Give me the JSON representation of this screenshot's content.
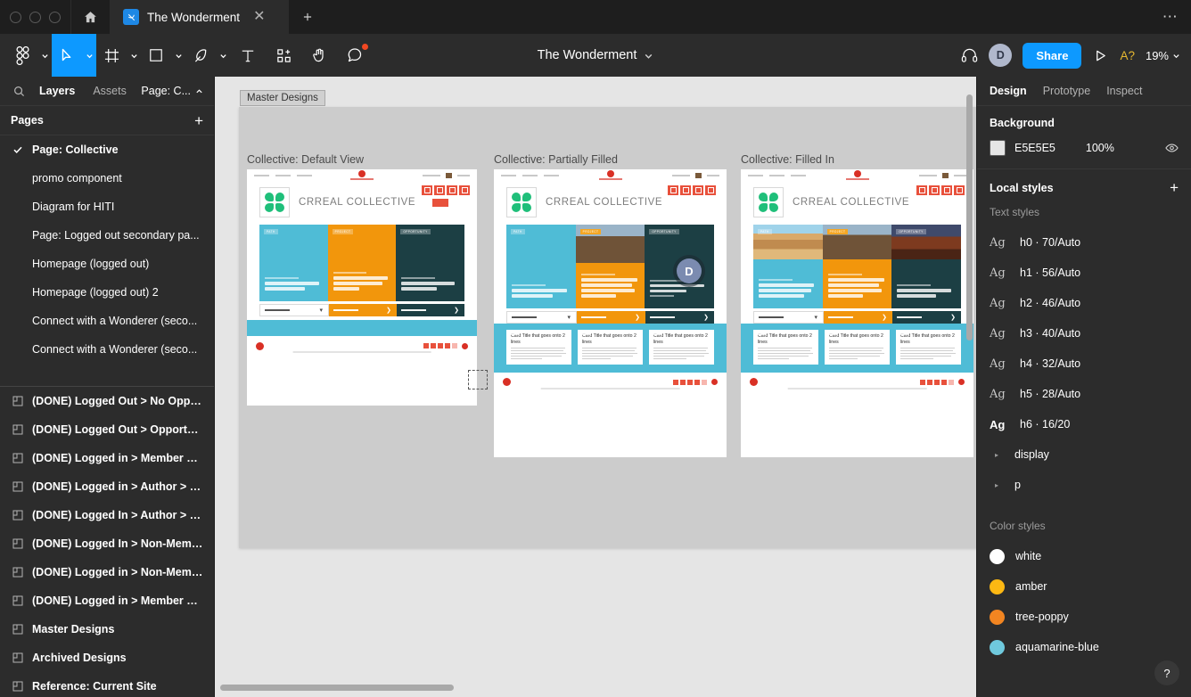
{
  "window": {
    "traffic_lights": [
      "close",
      "minimize",
      "maximize"
    ],
    "home_icon": "home-icon",
    "tab": {
      "label": "The Wonderment",
      "app_icon": "figma-file-icon",
      "close_icon": "close-icon"
    },
    "new_tab_icon": "plus-icon",
    "overflow_icon": "more-horizontal-icon"
  },
  "toolbar": {
    "tools": [
      {
        "name": "figma-menu",
        "icon": "figma-logo-icon",
        "caret": true,
        "active": false
      },
      {
        "name": "move-tool",
        "icon": "cursor-arrow-icon",
        "caret": true,
        "active": true
      },
      {
        "name": "frame-tool",
        "icon": "frame-icon",
        "caret": true,
        "active": false
      },
      {
        "name": "shape-tool",
        "icon": "square-icon",
        "caret": true,
        "active": false
      },
      {
        "name": "pen-tool",
        "icon": "pen-icon",
        "caret": true,
        "active": false
      },
      {
        "name": "text-tool",
        "icon": "text-t-icon",
        "caret": false,
        "active": false
      },
      {
        "name": "components-tool",
        "icon": "components-plus-icon",
        "caret": false,
        "active": false
      },
      {
        "name": "hand-tool",
        "icon": "hand-icon",
        "caret": false,
        "active": false
      },
      {
        "name": "comment-tool",
        "icon": "comment-icon",
        "caret": false,
        "active": false,
        "badge": true
      }
    ],
    "file_title": "The Wonderment",
    "file_title_caret_icon": "chevron-down-icon",
    "headphones_icon": "headphones-icon",
    "avatar_initial": "D",
    "share_label": "Share",
    "present_icon": "play-triangle-icon",
    "accessibility_label": "A?",
    "zoom_level": "19%",
    "zoom_caret_icon": "chevron-down-icon"
  },
  "left_panel": {
    "search_icon": "search-icon",
    "tabs": [
      {
        "label": "Layers",
        "selected": true
      },
      {
        "label": "Assets",
        "selected": false
      }
    ],
    "page_selector": {
      "label": "Page: C...",
      "icon": "chevron-up-icon"
    },
    "pages_header": {
      "label": "Pages",
      "add_icon": "plus-icon"
    },
    "pages_top": [
      {
        "label": "Page: Collective",
        "checked": true,
        "bold": true
      },
      {
        "label": "promo component",
        "checked": false,
        "bold": false
      },
      {
        "label": "Diagram for HITI",
        "checked": false,
        "bold": false
      },
      {
        "label": "Page: Logged out secondary pa...",
        "checked": false,
        "bold": false
      },
      {
        "label": "Homepage (logged out)",
        "checked": false,
        "bold": false
      },
      {
        "label": "Homepage (logged out) 2",
        "checked": false,
        "bold": false
      },
      {
        "label": "Connect with a Wonderer (seco...",
        "checked": false,
        "bold": false
      },
      {
        "label": "Connect with a Wonderer (seco...",
        "checked": false,
        "bold": false
      }
    ],
    "pages_bottom": [
      {
        "label": "(DONE) Logged Out > No Opportu...",
        "icon": "page-icon"
      },
      {
        "label": "(DONE) Logged Out > Opportunity",
        "icon": "page-icon"
      },
      {
        "label": "(DONE) Logged in > Member > Op...",
        "icon": "page-icon"
      },
      {
        "label": "(DONE) Logged in > Author > No ...",
        "icon": "page-icon"
      },
      {
        "label": "(DONE) Logged In > Author > Op...",
        "icon": "page-icon"
      },
      {
        "label": "(DONE) Logged In > Non-Member...",
        "icon": "page-icon"
      },
      {
        "label": "(DONE) Logged in > Non-Member...",
        "icon": "page-icon"
      },
      {
        "label": "(DONE) Logged in > Member > No...",
        "icon": "page-icon"
      },
      {
        "label": "Master Designs",
        "icon": "page-icon"
      },
      {
        "label": "Archived Designs",
        "icon": "page-icon"
      },
      {
        "label": "Reference: Current Site",
        "icon": "page-icon"
      }
    ]
  },
  "canvas": {
    "frame_tag": "Master Designs",
    "background_color": "#E5E5E5",
    "frame_color": "#CCCCCC",
    "artboards": [
      {
        "label": "Collective: Default View",
        "brand": "CRREAL COLLECTIVE",
        "panels": [
          {
            "tag": "PATH",
            "color": "#4FBCD6",
            "headline": "This Collective is working to create their first Path.",
            "has_image": false
          },
          {
            "tag": "PROJECT",
            "color": "#F2960C",
            "headline": "This Collective is working to create their first Project.",
            "has_image": false
          },
          {
            "tag": "OPPORTUNITY",
            "color": "#1C3F44",
            "headline": "Want to connect with this Collective?",
            "has_image": false
          }
        ],
        "buttons": [
          "MORE PATHS",
          "MORE PROJECTS",
          "MORE OPPORTUNITIES"
        ],
        "hero": "This Collective is working to create their first Path.",
        "cards": [],
        "avatar": null
      },
      {
        "label": "Collective: Partially Filled",
        "brand": "CRREAL COLLECTIVE",
        "panels": [
          {
            "tag": "PATH",
            "color": "#4FBCD6",
            "headline": "This Collective is working to create their first Path.",
            "has_image": false
          },
          {
            "tag": "PROJECT",
            "color": "#F2960C",
            "headline": "Lorem ipsum dolor sit amet, consectetur adipiscing elit, velit ac porttitor. Sed tincidunt imperdiet volutpat.",
            "has_image": true
          },
          {
            "tag": "OPPORTUNITY",
            "color": "#1C3F44",
            "headline": "Want to connect with this Colle...",
            "has_image": false
          }
        ],
        "buttons": [
          "MORE PATHS",
          "MORE PROJECTS",
          "MORE OPPORTUNITIES"
        ],
        "hero": null,
        "cards": [
          {
            "title": "Card Title that goes onto 2 lines"
          },
          {
            "title": "Card Title that goes onto 2 lines"
          },
          {
            "title": "Card Title that goes onto 2 lines"
          }
        ],
        "avatar": "D"
      },
      {
        "label": "Collective: Filled In",
        "brand": "CRREAL COLLECTIVE",
        "panels": [
          {
            "tag": "PATH",
            "color": "#4FBCD6",
            "headline": "Who is a person who has transformed your own relationship with nature?",
            "has_image": true
          },
          {
            "tag": "PROJECT",
            "color": "#F2960C",
            "headline": "Lorem ipsum dolor sit amet, consectetur adipiscing elit, velit ac porttitor. Sed tincidunt imperdiet volutpat.",
            "has_image": true
          },
          {
            "tag": "OPPORTUNITY",
            "color": "#1C3F44",
            "headline": "Lorem ipsum dolor sit amet, consectetur.",
            "has_image": true
          }
        ],
        "buttons": [
          "MORE PATHS",
          "MORE PROJECTS",
          "MORE OPPORTUNITIES"
        ],
        "hero": null,
        "cards": [
          {
            "title": "Card Title that goes onto 2 lines"
          },
          {
            "title": "Card Title that goes onto 2 lines"
          },
          {
            "title": "Card Title that goes onto 2 lines"
          }
        ],
        "avatar": null
      }
    ]
  },
  "right_panel": {
    "tabs": [
      {
        "label": "Design",
        "selected": true
      },
      {
        "label": "Prototype",
        "selected": false
      },
      {
        "label": "Inspect",
        "selected": false
      }
    ],
    "background": {
      "title": "Background",
      "hex": "E5E5E5",
      "opacity": "100%",
      "swatch_color": "#E5E5E5",
      "visibility_icon": "eye-icon"
    },
    "local_styles": {
      "title": "Local styles",
      "add_icon": "plus-icon",
      "text_styles_label": "Text styles",
      "text_styles": [
        {
          "sample": "Ag",
          "label": "h0 · 70/Auto",
          "bold_sample": false
        },
        {
          "sample": "Ag",
          "label": "h1 · 56/Auto",
          "bold_sample": false
        },
        {
          "sample": "Ag",
          "label": "h2 · 46/Auto",
          "bold_sample": false
        },
        {
          "sample": "Ag",
          "label": "h3 · 40/Auto",
          "bold_sample": false
        },
        {
          "sample": "Ag",
          "label": "h4 · 32/Auto",
          "bold_sample": false
        },
        {
          "sample": "Ag",
          "label": "h5 · 28/Auto",
          "bold_sample": false
        },
        {
          "sample": "Ag",
          "label": "h6 · 16/20",
          "bold_sample": true
        }
      ],
      "text_style_groups": [
        {
          "label": "display",
          "expand_icon": "triangle-right-icon"
        },
        {
          "label": "p",
          "expand_icon": "triangle-right-icon"
        }
      ],
      "color_styles_label": "Color styles",
      "color_styles": [
        {
          "label": "white",
          "color": "#FFFFFF"
        },
        {
          "label": "amber",
          "color": "#FCB813"
        },
        {
          "label": "tree-poppy",
          "color": "#F28521"
        },
        {
          "label": "aquamarine-blue",
          "color": "#6FC9DD"
        }
      ]
    },
    "help_label": "?"
  }
}
